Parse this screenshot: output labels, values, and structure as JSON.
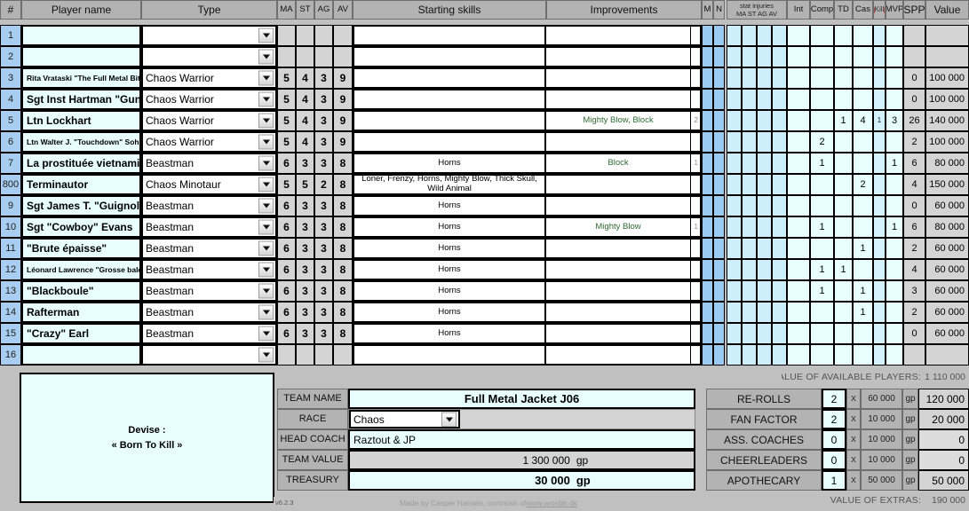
{
  "table": {
    "headers": {
      "num": "#",
      "player_name": "Player name",
      "type": "Type",
      "ma": "MA",
      "st": "ST",
      "ag": "AG",
      "av": "AV",
      "starting_skills": "Starting skills",
      "improvements": "Improvements",
      "m": "M",
      "n": "N",
      "stat_injuries": "stat injuries",
      "stat_injuries_sub": "MA ST AG AV",
      "int": "Int",
      "comp": "Comp",
      "td": "TD",
      "cas": "Cas",
      "kill": "Kill",
      "mvp": "MVP",
      "spp": "SPP",
      "value": "Value"
    },
    "rows": [
      {
        "num": "1",
        "name": "",
        "type": "",
        "ma": "",
        "st": "",
        "ag": "",
        "av": "",
        "skills": "",
        "improvements": "",
        "impnum": "",
        "int": "",
        "comp": "",
        "td": "",
        "cas": "",
        "kill": "",
        "mvp": "",
        "spp": "",
        "value": ""
      },
      {
        "num": "2",
        "name": "",
        "type": "",
        "ma": "",
        "st": "",
        "ag": "",
        "av": "",
        "skills": "",
        "improvements": "",
        "impnum": "",
        "int": "",
        "comp": "",
        "td": "",
        "cas": "",
        "kill": "",
        "mvp": "",
        "spp": "",
        "value": ""
      },
      {
        "num": "3",
        "name": "Rita Vrataski \"The Full Metal Bitch\"",
        "name_size": "tiny",
        "type": "Chaos Warrior",
        "ma": "5",
        "st": "4",
        "ag": "3",
        "av": "9",
        "skills": "",
        "improvements": "",
        "impnum": "",
        "int": "",
        "comp": "",
        "td": "",
        "cas": "",
        "kill": "",
        "mvp": "",
        "spp": "0",
        "value": "100 000"
      },
      {
        "num": "4",
        "name": "Sgt Inst Hartman \"Gunnery\"",
        "type": "Chaos Warrior",
        "ma": "5",
        "st": "4",
        "ag": "3",
        "av": "9",
        "skills": "",
        "improvements": "",
        "impnum": "",
        "int": "",
        "comp": "",
        "td": "",
        "cas": "",
        "kill": "",
        "mvp": "",
        "spp": "0",
        "value": "100 000"
      },
      {
        "num": "5",
        "name": "Ltn Lockhart",
        "type": "Chaos Warrior",
        "ma": "5",
        "st": "4",
        "ag": "3",
        "av": "9",
        "skills": "",
        "improvements": "Mighty Blow, Block",
        "impnum": "2",
        "int": "",
        "comp": "",
        "td": "1",
        "cas": "4",
        "kill": "1",
        "mvp": "3",
        "spp": "26",
        "value": "140 000"
      },
      {
        "num": "6",
        "name": "Ltn Walter J. \"Touchdown\" Sohinowski",
        "name_size": "tiny",
        "type": "Chaos Warrior",
        "ma": "5",
        "st": "4",
        "ag": "3",
        "av": "9",
        "skills": "",
        "improvements": "",
        "impnum": "",
        "int": "",
        "comp": "2",
        "td": "",
        "cas": "",
        "kill": "",
        "mvp": "",
        "spp": "2",
        "value": "100 000"
      },
      {
        "num": "7",
        "name": "La prostituée vietnamienne",
        "type": "Beastman",
        "ma": "6",
        "st": "3",
        "ag": "3",
        "av": "8",
        "skills": "Horns",
        "improvements": "Block",
        "impnum": "1",
        "int": "",
        "comp": "1",
        "td": "",
        "cas": "",
        "kill": "",
        "mvp": "1",
        "spp": "6",
        "value": "80 000"
      },
      {
        "num": "800",
        "name": "Terminautor",
        "type": "Chaos Minotaur",
        "ma": "5",
        "st": "5",
        "ag": "2",
        "av": "8",
        "skills": "Loner, Frenzy, Horns, Mighty Blow, Thick Skull, Wild Animal",
        "improvements": "",
        "impnum": "",
        "int": "",
        "comp": "",
        "td": "",
        "cas": "2",
        "kill": "",
        "mvp": "",
        "spp": "4",
        "value": "150 000"
      },
      {
        "num": "9",
        "name": "Sgt James T. \"Guignol\"",
        "type": "Beastman",
        "ma": "6",
        "st": "3",
        "ag": "3",
        "av": "8",
        "skills": "Horns",
        "improvements": "",
        "impnum": "",
        "int": "",
        "comp": "",
        "td": "",
        "cas": "",
        "kill": "",
        "mvp": "",
        "spp": "0",
        "value": "60 000"
      },
      {
        "num": "10",
        "name": "Sgt \"Cowboy\" Evans",
        "type": "Beastman",
        "ma": "6",
        "st": "3",
        "ag": "3",
        "av": "8",
        "skills": "Horns",
        "improvements": "Mighty Blow",
        "impnum": "1",
        "int": "",
        "comp": "1",
        "td": "",
        "cas": "",
        "kill": "",
        "mvp": "1",
        "spp": "6",
        "value": "80 000"
      },
      {
        "num": "11",
        "name": "\"Brute épaisse\"",
        "type": "Beastman",
        "ma": "6",
        "st": "3",
        "ag": "3",
        "av": "8",
        "skills": "Horns",
        "improvements": "",
        "impnum": "",
        "int": "",
        "comp": "",
        "td": "",
        "cas": "1",
        "kill": "",
        "mvp": "",
        "spp": "2",
        "value": "60 000"
      },
      {
        "num": "12",
        "name": "Léonard Lawrence \"Grosse baleine\"",
        "name_size": "tiny",
        "type": "Beastman",
        "ma": "6",
        "st": "3",
        "ag": "3",
        "av": "8",
        "skills": "Horns",
        "improvements": "",
        "impnum": "",
        "int": "",
        "comp": "1",
        "td": "1",
        "cas": "",
        "kill": "",
        "mvp": "",
        "spp": "4",
        "value": "60 000"
      },
      {
        "num": "13",
        "name": "\"Blackboule\"",
        "type": "Beastman",
        "ma": "6",
        "st": "3",
        "ag": "3",
        "av": "8",
        "skills": "Horns",
        "improvements": "",
        "impnum": "",
        "int": "",
        "comp": "1",
        "td": "",
        "cas": "1",
        "kill": "",
        "mvp": "",
        "spp": "3",
        "value": "60 000"
      },
      {
        "num": "14",
        "name": "Rafterman",
        "type": "Beastman",
        "ma": "6",
        "st": "3",
        "ag": "3",
        "av": "8",
        "skills": "Horns",
        "improvements": "",
        "impnum": "",
        "int": "",
        "comp": "",
        "td": "",
        "cas": "1",
        "kill": "",
        "mvp": "",
        "spp": "2",
        "value": "60 000"
      },
      {
        "num": "15",
        "name": "\"Crazy\" Earl",
        "type": "Beastman",
        "ma": "6",
        "st": "3",
        "ag": "3",
        "av": "8",
        "skills": "Horns",
        "improvements": "",
        "impnum": "",
        "int": "",
        "comp": "",
        "td": "",
        "cas": "",
        "kill": "",
        "mvp": "",
        "spp": "0",
        "value": "60 000"
      },
      {
        "num": "16",
        "name": "",
        "type": "",
        "ma": "",
        "st": "",
        "ag": "",
        "av": "",
        "skills": "",
        "improvements": "",
        "impnum": "",
        "int": "",
        "comp": "",
        "td": "",
        "cas": "",
        "kill": "",
        "mvp": "",
        "spp": "",
        "value": ""
      }
    ]
  },
  "motto": {
    "label": "Devise :",
    "text": "« Born To Kill »"
  },
  "team": {
    "team_name_label": "TEAM NAME",
    "team_name_value": "Full Metal Jacket J06",
    "race_label": "RACE",
    "race_value": "Chaos",
    "head_coach_label": "HEAD COACH",
    "head_coach_value": "Raztout & JP",
    "team_value_label": "TEAM VALUE",
    "team_value_value": "1 300 000",
    "team_value_gp": "gp",
    "treasury_label": "TREASURY",
    "treasury_value": "30 000",
    "treasury_gp": "gp"
  },
  "extras": {
    "available_players_label": "VALUE OF AVAILABLE PLAYERS:",
    "available_players_value": "1 110 000",
    "rows": [
      {
        "label": "RE-ROLLS",
        "qty": "2",
        "x": "x",
        "price": "60 000",
        "gp": "gp",
        "total": "120 000"
      },
      {
        "label": "FAN FACTOR",
        "qty": "2",
        "x": "x",
        "price": "10 000",
        "gp": "gp",
        "total": "20 000"
      },
      {
        "label": "ASS. COACHES",
        "qty": "0",
        "x": "x",
        "price": "10 000",
        "gp": "gp",
        "total": "0"
      },
      {
        "label": "CHEERLEADERS",
        "qty": "0",
        "x": "x",
        "price": "10 000",
        "gp": "gp",
        "total": "0"
      },
      {
        "label": "APOTHECARY",
        "qty": "1",
        "x": "x",
        "price": "50 000",
        "gp": "gp",
        "total": "50 000"
      }
    ],
    "extras_label": "VALUE OF EXTRAS:",
    "extras_value": "190 000"
  },
  "footer": {
    "version": "v6.2.3",
    "credit": "Made by  Casper Hansen,  commish of ",
    "link": "www.arosbb.dk"
  }
}
